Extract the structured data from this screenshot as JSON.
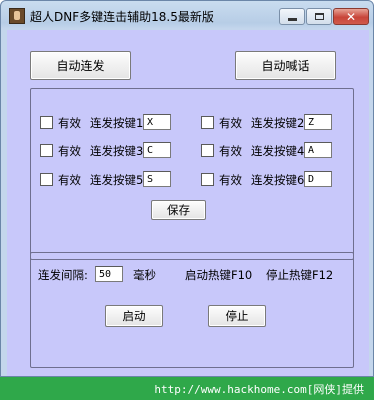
{
  "window": {
    "title": "超人DNF多键连击辅助18.5最新版"
  },
  "top_buttons": {
    "auto_fire": "自动连发",
    "auto_shout": "自动喊话"
  },
  "keys": [
    {
      "enabled_label": "有效",
      "key_label": "连发按键1",
      "value": "X"
    },
    {
      "enabled_label": "有效",
      "key_label": "连发按键2",
      "value": "Z"
    },
    {
      "enabled_label": "有效",
      "key_label": "连发按键3",
      "value": "C"
    },
    {
      "enabled_label": "有效",
      "key_label": "连发按键4",
      "value": "A"
    },
    {
      "enabled_label": "有效",
      "key_label": "连发按键5",
      "value": "S"
    },
    {
      "enabled_label": "有效",
      "key_label": "连发按键6",
      "value": "D"
    }
  ],
  "save_label": "保存",
  "interval": {
    "label": "连发间隔:",
    "value": "50",
    "unit": "毫秒"
  },
  "hotkeys": {
    "start": "启动热键F10",
    "stop": "停止热键F12"
  },
  "controls": {
    "start": "启动",
    "stop": "停止"
  },
  "footer": {
    "text": "http://www.hackhome.com[网侠]提供"
  }
}
